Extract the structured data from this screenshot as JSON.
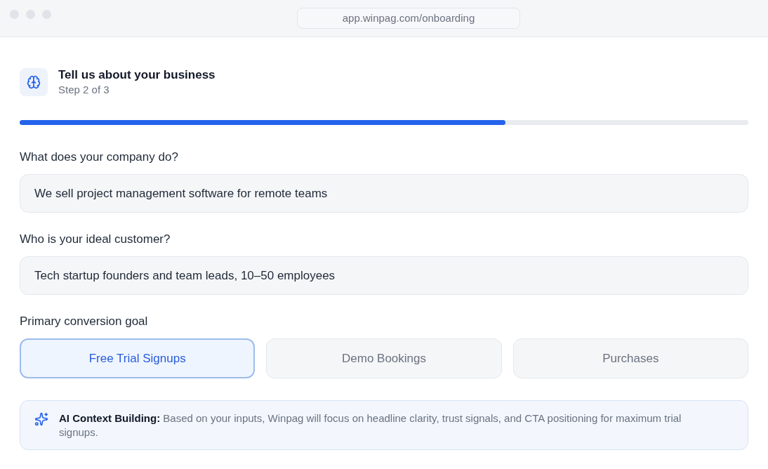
{
  "browser": {
    "url": "app.winpag.com/onboarding"
  },
  "header": {
    "title": "Tell us about your business",
    "step": "Step 2 of 3"
  },
  "progress": {
    "level": 0.667
  },
  "fields": [
    {
      "label": "What does your company do?",
      "value": "We sell project management software for remote teams"
    },
    {
      "label": "Who is your ideal customer?",
      "value": "Tech startup founders and team leads, 10–50 employees"
    }
  ],
  "goal": {
    "label": "Primary conversion goal",
    "options": [
      {
        "label": "Free Trial Signups",
        "selected": true
      },
      {
        "label": "Demo Bookings",
        "selected": false
      },
      {
        "label": "Purchases",
        "selected": false
      }
    ]
  },
  "note": {
    "text": "**AI Context Building:** Based on your inputs, Winpag will focus on headline clarity, trust signals, and CTA positioning for maximum trial signups."
  }
}
